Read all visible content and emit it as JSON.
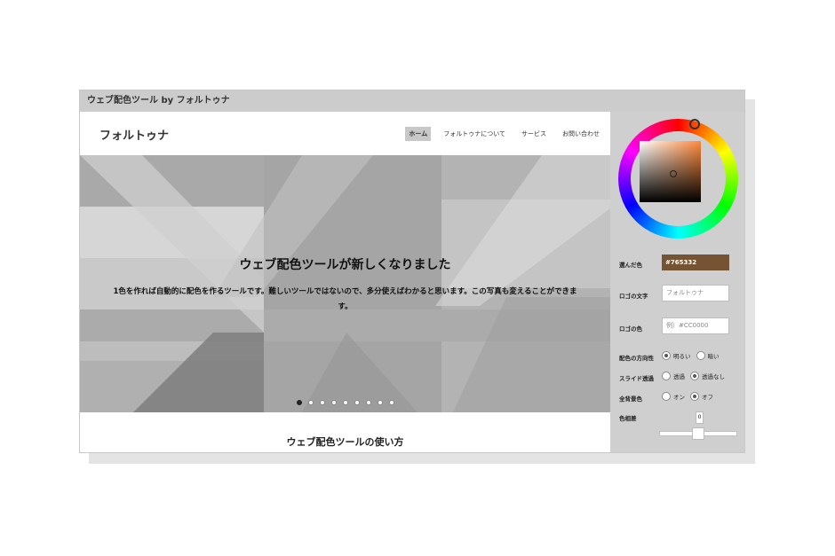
{
  "window": {
    "title": "ウェブ配色ツール by フォルトゥナ"
  },
  "site": {
    "logo": "フォルトゥナ",
    "nav": [
      {
        "label": "ホーム",
        "active": true
      },
      {
        "label": "フォルトゥナについて",
        "active": false
      },
      {
        "label": "サービス",
        "active": false
      },
      {
        "label": "お問い合わせ",
        "active": false
      }
    ],
    "hero": {
      "title": "ウェブ配色ツールが新しくなりました",
      "body": "1色を作れば自動的に配色を作るツールです。難しいツールではないので、多分使えばわかると思います。この写真も変えることができます。",
      "slide_count": 9,
      "active_slide": 1
    },
    "section_title": "ウェブ配色ツールの使い方"
  },
  "panel": {
    "selected_color_label": "選んだ色",
    "selected_color_value": "#765332",
    "selected_color_hex": "#765332",
    "logo_text_label": "ロゴの文字",
    "logo_text_placeholder": "フォルトゥナ",
    "logo_color_label": "ロゴの色",
    "logo_color_placeholder": "例）#CC0000",
    "direction_label": "配色の方向性",
    "direction_options": [
      {
        "label": "明るい",
        "checked": true
      },
      {
        "label": "暗い",
        "checked": false
      }
    ],
    "slide_transparency_label": "スライド透過",
    "slide_transparency_options": [
      {
        "label": "透過",
        "checked": false
      },
      {
        "label": "透過なし",
        "checked": true
      }
    ],
    "full_bg_label": "全背景色",
    "full_bg_options": [
      {
        "label": "オン",
        "checked": false
      },
      {
        "label": "オフ",
        "checked": true
      }
    ],
    "hue_diff_label": "色相差",
    "hue_diff_value": "0"
  }
}
